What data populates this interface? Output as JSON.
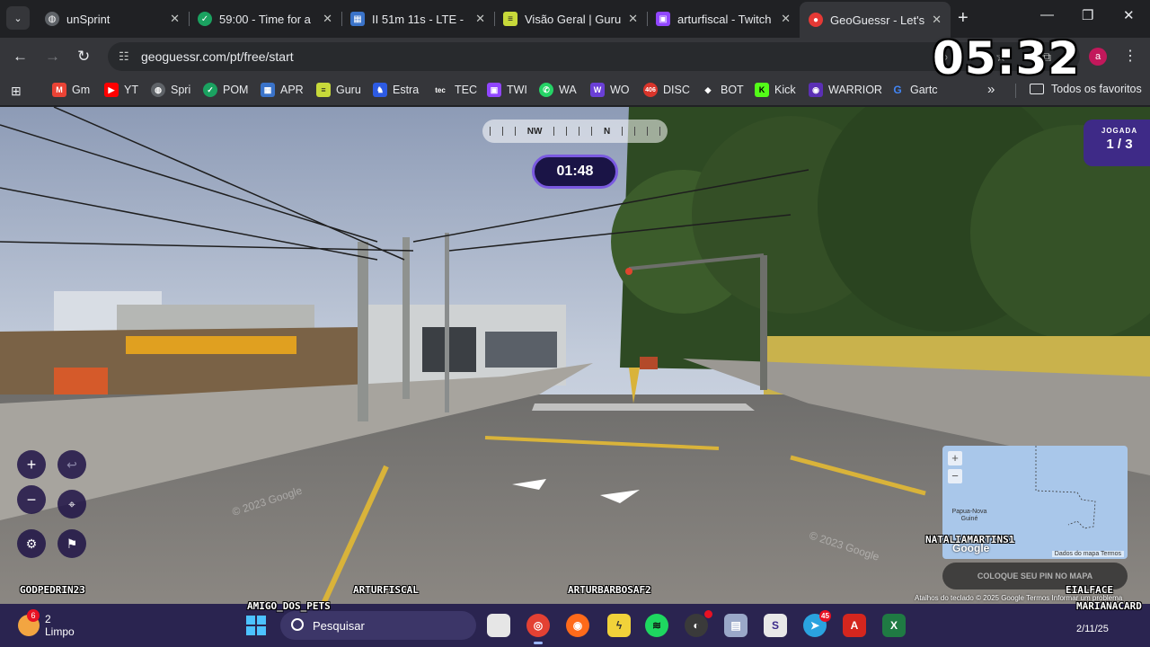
{
  "browser": {
    "tabs": [
      {
        "title": "unSprint",
        "icon": "globe-icon"
      },
      {
        "title": "59:00 - Time for a",
        "icon": "check-circle-icon"
      },
      {
        "title": "II 51m 11s - LTE -",
        "icon": "map-icon"
      },
      {
        "title": "Visão Geral | Guru",
        "icon": "guru-icon"
      },
      {
        "title": "arturfiscal - Twitch",
        "icon": "twitch-icon"
      },
      {
        "title": "GeoGuessr - Let's",
        "icon": "location-pin-icon",
        "active": true
      }
    ],
    "url": "geoguessr.com/pt/free/start",
    "profile_initial": "a",
    "bookmarks": [
      {
        "label": "Gm",
        "icon": "gmail-icon"
      },
      {
        "label": "YT",
        "icon": "youtube-icon"
      },
      {
        "label": "Spri",
        "icon": "globe-icon"
      },
      {
        "label": "POM",
        "icon": "check-circle-icon"
      },
      {
        "label": "APR",
        "icon": "map-icon"
      },
      {
        "label": "Guru",
        "icon": "guru-icon"
      },
      {
        "label": "Estra",
        "icon": "estra-icon"
      },
      {
        "label": "TEC",
        "icon": "tec-icon",
        "badge": "tec"
      },
      {
        "label": "TWI",
        "icon": "twitch-icon"
      },
      {
        "label": "WA",
        "icon": "whatsapp-icon"
      },
      {
        "label": "WO",
        "icon": "wo-icon",
        "badge": "W"
      },
      {
        "label": "DISC",
        "icon": "discord-icon",
        "badge": "406"
      },
      {
        "label": "BOT",
        "icon": "bot-icon"
      },
      {
        "label": "Kick",
        "icon": "kick-icon",
        "badge": "K"
      },
      {
        "label": "WARRIOR",
        "icon": "warrior-icon"
      },
      {
        "label": "Gartc",
        "icon": "google-icon",
        "badge": "G"
      }
    ],
    "all_bookmarks_label": "Todos os favoritos"
  },
  "overlay": {
    "stream_timer": "05:32",
    "chat_names": [
      "GODPEDRIN23",
      "AMIGO_DOS_PETS",
      "ARTURFISCAL",
      "ARTURBARBOSAF2",
      "NATALIAMARTINS1",
      "EIALFACE",
      "MARIANACARD"
    ]
  },
  "game": {
    "compass": {
      "left": "NW",
      "right": "N"
    },
    "timer": "01:48",
    "round": {
      "label": "JOGADA",
      "value": "1 / 3"
    },
    "minimap": {
      "place_label": "Papua-Nova Guiné",
      "footer_label": "Dados do mapa",
      "terms": "Termos"
    },
    "guess_button": "COLOQUE SEU PIN NO MAPA",
    "attribution": {
      "google": "Google",
      "shortcuts": "Atalhos do teclado",
      "data": "© 2025 Google",
      "terms": "Termos",
      "report": "Informar um problema"
    },
    "watermark": "© 2023 Google"
  },
  "taskbar": {
    "weather": {
      "temp": "2",
      "condition": "Limpo",
      "badge": "6"
    },
    "search_placeholder": "Pesquisar",
    "apps": [
      {
        "name": "file-explorer-icon"
      },
      {
        "name": "chrome-icon",
        "badge": "",
        "active": true
      },
      {
        "name": "firefox-icon"
      },
      {
        "name": "pikachu-app-icon"
      },
      {
        "name": "spotify-icon"
      },
      {
        "name": "obs-icon"
      },
      {
        "name": "app-icon"
      },
      {
        "name": "streamlabs-icon"
      },
      {
        "name": "telegram-icon",
        "badge": "45"
      },
      {
        "name": "acrobat-icon"
      },
      {
        "name": "excel-icon"
      }
    ],
    "clock_date": "2/11/25"
  }
}
